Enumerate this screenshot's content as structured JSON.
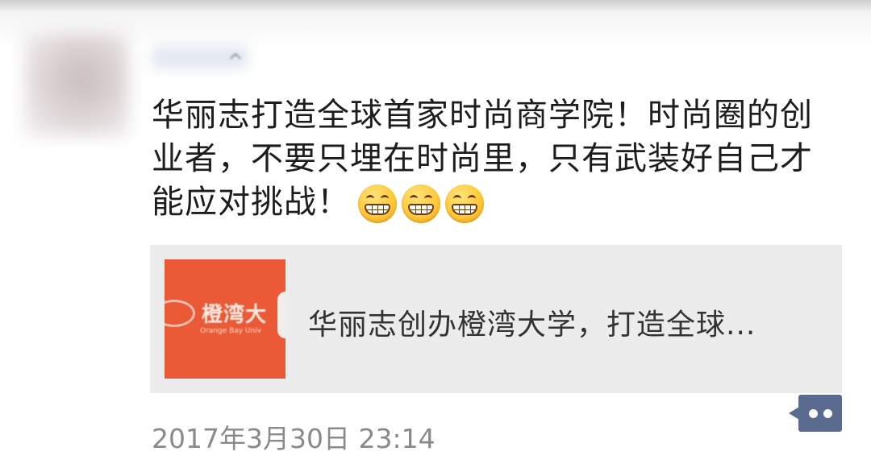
{
  "post": {
    "text": "华丽志打造全球首家时尚商学院！时尚圈的创业者，不要只埋在时尚里，只有武装好自己才能应对挑战！",
    "emojis": [
      "grin-emoji",
      "grin-emoji",
      "grin-emoji"
    ],
    "link": {
      "thumbnail_title": "橙湾大",
      "thumbnail_subtitle": "Orange Bay Univ",
      "title": "华丽志创办橙湾大学，打造全球..."
    },
    "timestamp": "2017年3月30日 23:14",
    "comment_icon": "more-comment-icon"
  },
  "colors": {
    "thumbnail_bg": "#eb5a36",
    "card_bg": "#ececec",
    "comment_button": "#5b6b8f",
    "timestamp": "#8a8a8a"
  }
}
